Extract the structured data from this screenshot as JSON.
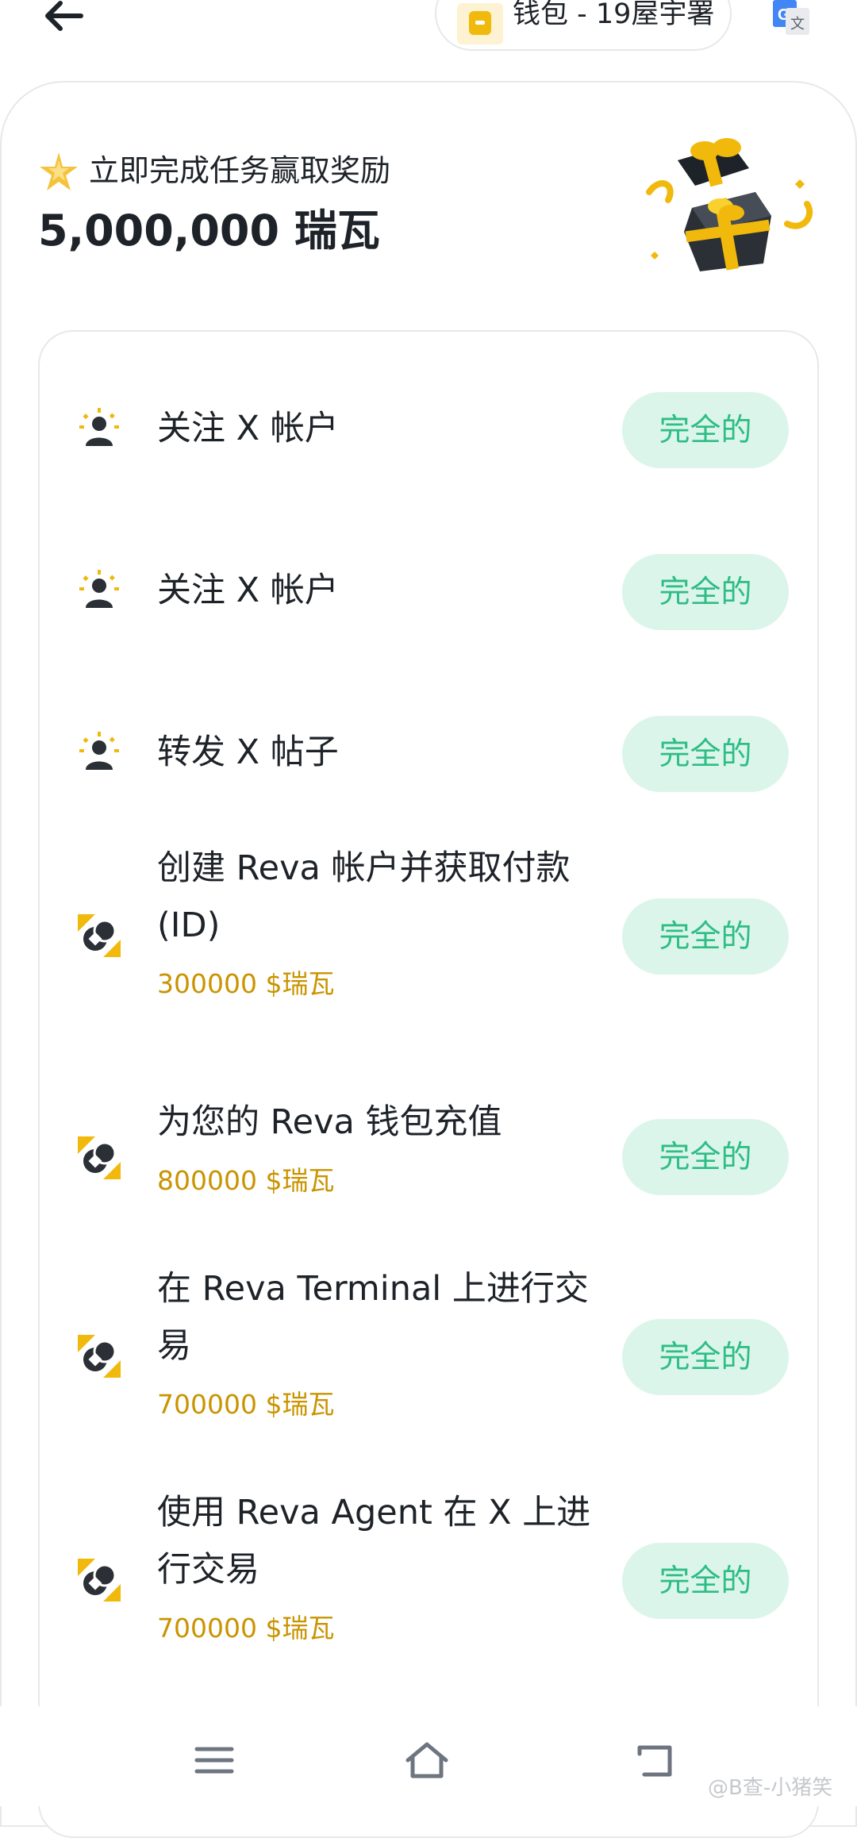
{
  "header": {
    "wallet_label": "钱包 - 19屋宇署"
  },
  "hero": {
    "subtitle": "立即完成任务赢取奖励",
    "amount": "5,000,000 瑞瓦"
  },
  "tasks": [
    {
      "title": "关注 X 帐户",
      "reward": "",
      "icon": "social-user-icon",
      "button": "完全的"
    },
    {
      "title": "关注 X 帐户",
      "reward": "",
      "icon": "social-user-icon",
      "button": "完全的"
    },
    {
      "title": "转发 X 帖子",
      "reward": "",
      "icon": "social-user-icon",
      "button": "完全的"
    },
    {
      "title": "创建 Reva 帐户并获取付款(ID)",
      "reward": "300000 $瑞瓦",
      "icon": "coin-icon",
      "button": "完全的"
    },
    {
      "title": "为您的 Reva 钱包充值",
      "reward": "800000 $瑞瓦",
      "icon": "coin-icon",
      "button": "完全的"
    },
    {
      "title": "在 Reva Terminal 上进行交易",
      "reward": "700000 $瑞瓦",
      "icon": "coin-icon",
      "button": "完全的"
    },
    {
      "title": "使用 Reva Agent 在 X 上进行交易",
      "reward": "700000 $瑞瓦",
      "icon": "coin-icon",
      "button": "完全的"
    }
  ],
  "watermark": "@B查-小猪笑",
  "colors": {
    "accent_yellow": "#f0b90b",
    "reward_text": "#c99400",
    "complete_bg": "#dcf5ea",
    "complete_text": "#2ebd85"
  }
}
